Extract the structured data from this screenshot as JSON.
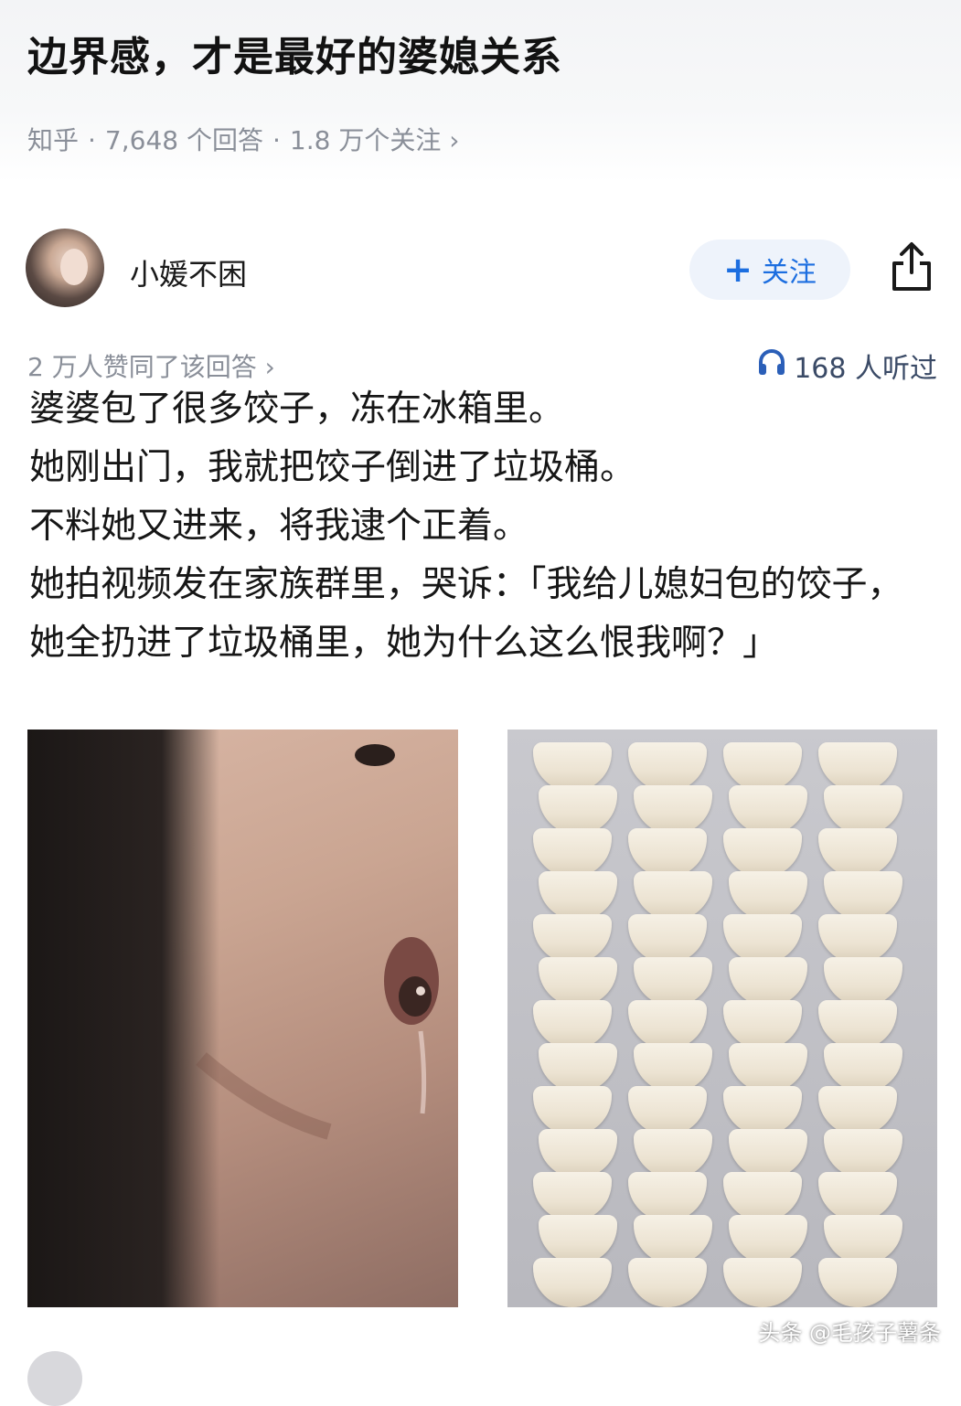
{
  "question": {
    "title": "边界感，才是最好的婆媳关系",
    "source": "知乎",
    "answers_count": "7,648 个回答",
    "followers": "1.8 万个关注",
    "separator": "·",
    "chevron": "›"
  },
  "answer": {
    "author_name": "小媛不困",
    "follow_label": "关注",
    "follow_icon": "plus-icon",
    "share_icon": "share-icon",
    "agree_text": "2 万人赞同了该回答 ›",
    "listen_icon": "headphones-icon",
    "listen_text": "168 人听过",
    "paragraphs": [
      "婆婆包了很多饺子，冻在冰箱里。",
      "她刚出门，我就把饺子倒进了垃圾桶。",
      "不料她又进来，将我逮个正着。",
      "她拍视频发在家族群里，哭诉：「我给儿媳妇包的饺子，她全扔进了垃圾桶里，她为什么这么恨我啊？」"
    ]
  },
  "images": {
    "left_alt": "crying woman close-up",
    "right_alt": "tray of frozen dumplings"
  },
  "watermark": "头条 @毛孩子薯条"
}
